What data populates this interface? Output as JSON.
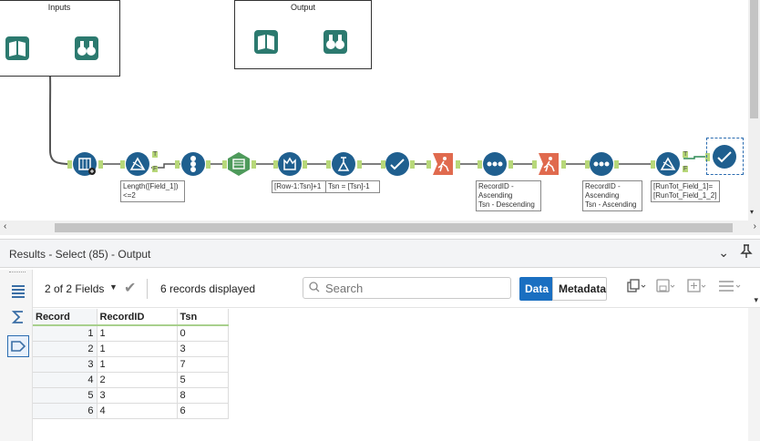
{
  "canvas": {
    "containers": [
      {
        "id": "inputs",
        "title": "Inputs"
      },
      {
        "id": "output",
        "title": "Output"
      }
    ],
    "annotations": {
      "filter1": "Length([Field_1])\n<=2",
      "multirow": "[Row-1:Tsn]+1",
      "formula": "Tsn = [Tsn]-1",
      "sort1": "RecordID -\nAscending\nTsn - Descending",
      "sort2": "RecordID -\nAscending\nTsn - Ascending",
      "filter2": "[RunTot_Field_1]=\n[RunTot_Field_1_2]"
    },
    "anchor_labels": {
      "true": "T",
      "false": "F"
    }
  },
  "results": {
    "title": "Results - Select (85) - Output",
    "toolbar": {
      "fields_label": "2 of 2 Fields",
      "records_label": "6 records displayed",
      "search_placeholder": "Search",
      "data_label": "Data",
      "metadata_label": "Metadata"
    },
    "table": {
      "headers": [
        "Record",
        "RecordID",
        "Tsn"
      ],
      "rows": [
        [
          "1",
          "1",
          "0"
        ],
        [
          "2",
          "1",
          "3"
        ],
        [
          "3",
          "1",
          "7"
        ],
        [
          "4",
          "2",
          "5"
        ],
        [
          "5",
          "3",
          "8"
        ],
        [
          "6",
          "4",
          "6"
        ]
      ]
    }
  },
  "colors": {
    "accent": "#1a6fc1",
    "tool_blue": "#1f5f8f",
    "tool_green": "#4e9a5b",
    "tool_orange": "#e06a4e",
    "connector": "#b8d87a"
  }
}
